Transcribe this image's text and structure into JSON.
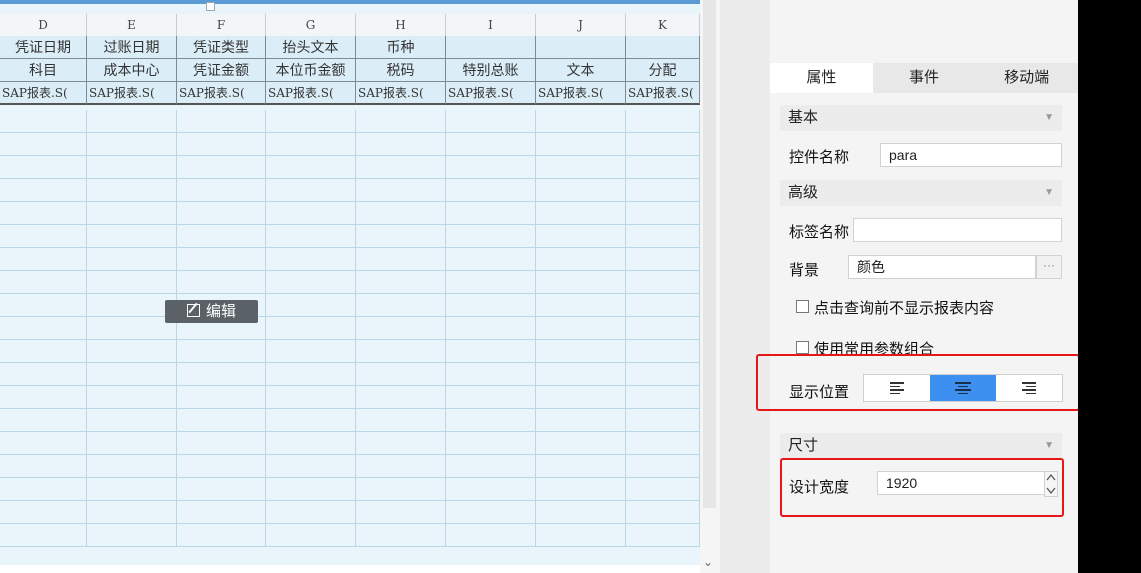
{
  "sheet": {
    "columns": [
      {
        "letter": "D",
        "width": 87
      },
      {
        "letter": "E",
        "width": 90
      },
      {
        "letter": "F",
        "width": 89
      },
      {
        "letter": "G",
        "width": 90
      },
      {
        "letter": "H",
        "width": 90
      },
      {
        "letter": "I",
        "width": 90
      },
      {
        "letter": "J",
        "width": 90
      },
      {
        "letter": "K",
        "width": 74
      }
    ],
    "header_row1": [
      "凭证日期",
      "过账日期",
      "凭证类型",
      "抬头文本",
      "币种",
      "",
      "",
      ""
    ],
    "header_row2": [
      "科目",
      "成本中心",
      "凭证金额",
      "本位币金额",
      "税码",
      "特别总账",
      "文本",
      "分配"
    ],
    "header_row3": [
      "SAP报表.S(",
      "SAP报表.S(",
      "SAP报表.S(",
      "SAP报表.S(",
      "SAP报表.S(",
      "SAP报表.S(",
      "SAP报表.S(",
      "SAP报表.S("
    ],
    "empty_rows": 19,
    "edit_button_label": "编辑"
  },
  "panel": {
    "tabs": [
      {
        "label": "属性",
        "active": true
      },
      {
        "label": "事件",
        "active": false
      },
      {
        "label": "移动端",
        "active": false
      }
    ],
    "section_basic": "基本",
    "control_name_label": "控件名称",
    "control_name_value": "para",
    "section_advanced": "高级",
    "tag_name_label": "标签名称",
    "tag_name_value": "",
    "background_label": "背景",
    "background_value": "颜色",
    "more_button": "···",
    "checkbox_hide_before_query": "点击查询前不显示报表内容",
    "checkbox_common_params": "使用常用参数组合",
    "display_position_label": "显示位置",
    "display_position_options": [
      "left",
      "center",
      "right"
    ],
    "display_position_selected": "center",
    "section_size": "尺寸",
    "design_width_label": "设计宽度",
    "design_width_value": "1920"
  },
  "colors": {
    "highlight_red": "#e8151b",
    "active_blue": "#3d8ff0"
  }
}
